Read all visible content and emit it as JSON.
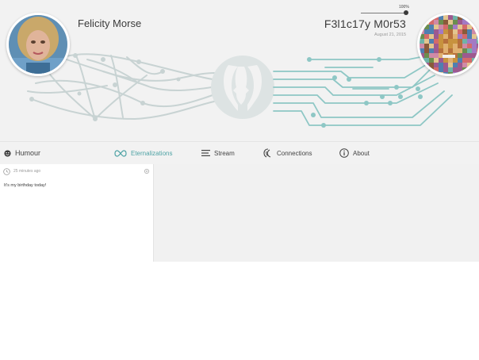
{
  "profile": {
    "name": "Felicity Morse",
    "alias": "F3l1c17y M0r53",
    "date": "August 21, 2015",
    "slider_label": "100%",
    "slider_value": 1.0
  },
  "nav": {
    "humour": "Humour",
    "tabs": [
      {
        "label": "Eternalizations",
        "icon": "infinity-icon",
        "active": true
      },
      {
        "label": "Stream",
        "icon": "lines-icon",
        "active": false
      },
      {
        "label": "Connections",
        "icon": "connections-icon",
        "active": false
      },
      {
        "label": "About",
        "icon": "info-icon",
        "active": false
      }
    ]
  },
  "post": {
    "time": "25 minutes ago",
    "text": "It's my birthday today!"
  },
  "colors": {
    "accent": "#4fa3a5",
    "network_left": "#c6d2d2",
    "network_right": "#8cc6c4",
    "header_bg": "#f2f2f2"
  }
}
